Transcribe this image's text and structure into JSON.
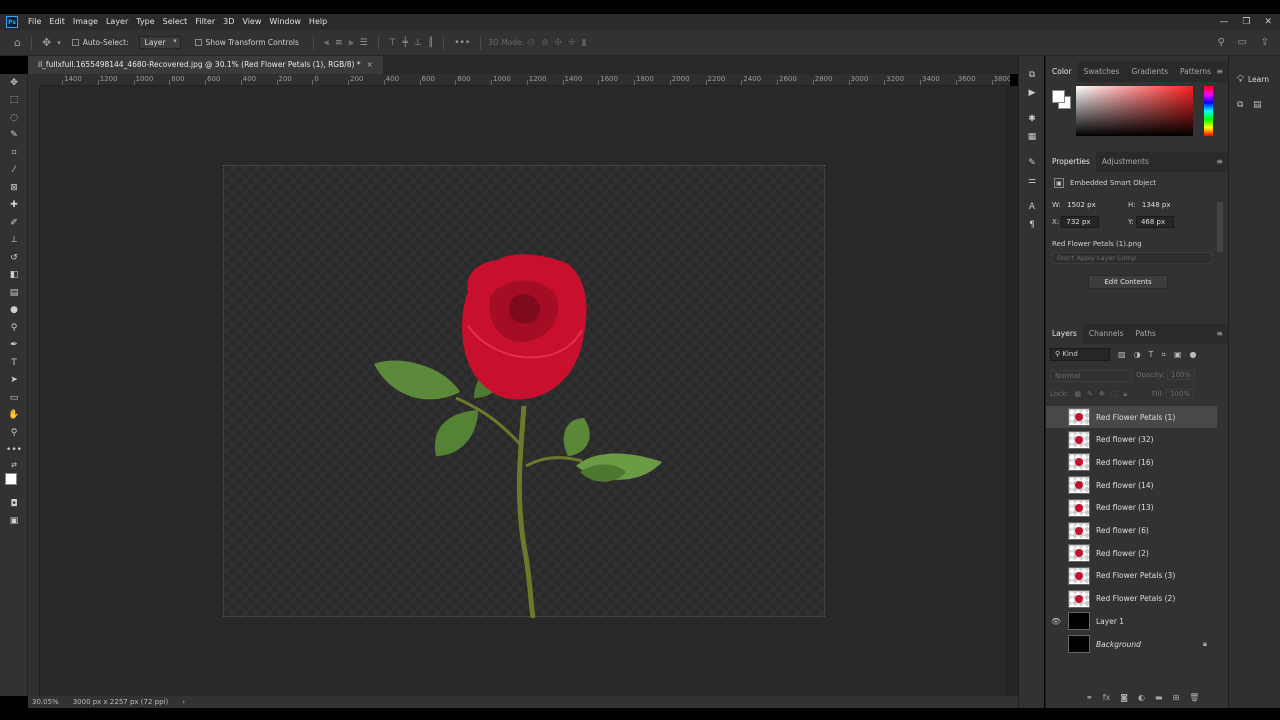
{
  "menu": {
    "logo": "Ps",
    "items": [
      "File",
      "Edit",
      "Image",
      "Layer",
      "Type",
      "Select",
      "Filter",
      "3D",
      "View",
      "Window",
      "Help"
    ],
    "window_controls": [
      "—",
      "❐",
      "✕"
    ]
  },
  "options": {
    "auto_select_label": "Auto-Select:",
    "auto_select_value": "Layer",
    "show_transform_label": "Show Transform Controls",
    "mode_3d_label": "3D Mode:"
  },
  "document": {
    "tab_title": "il_fullxfull.1655498144_4680-Recovered.jpg @ 30.1% (Red Flower Petals (1), RGB/8) *",
    "close_glyph": "×"
  },
  "ruler": {
    "h_ticks": [
      "1400",
      "1200",
      "1000",
      "800",
      "600",
      "400",
      "200",
      "0",
      "200",
      "400",
      "600",
      "800",
      "1000",
      "1200",
      "1400",
      "1600",
      "1800",
      "2000",
      "2200",
      "2400",
      "2600",
      "2800",
      "3000",
      "3200",
      "3400",
      "3600",
      "3800"
    ]
  },
  "status": {
    "zoom": "30.05%",
    "doc_size": "3000 px x 2257 px (72 ppi)",
    "arrow": "›"
  },
  "color_panel": {
    "tabs": [
      "Color",
      "Swatches",
      "Gradients",
      "Patterns"
    ]
  },
  "properties_panel": {
    "tabs": [
      "Properties",
      "Adjustments"
    ],
    "object_type": "Embedded Smart Object",
    "w_label": "W:",
    "w_value": "1502 px",
    "h_label": "H:",
    "h_value": "1348 px",
    "x_label": "X:",
    "x_value": "732 px",
    "y_label": "Y:",
    "y_value": "468 px",
    "file_name": "Red Flower Petals (1).png",
    "layer_comp": "Don't Apply Layer Comp",
    "edit_contents": "Edit Contents"
  },
  "layers_panel": {
    "tabs": [
      "Layers",
      "Channels",
      "Paths"
    ],
    "filter_kind": "Kind",
    "blend_mode": "Normal",
    "opacity_label": "Opacity:",
    "opacity_value": "100%",
    "lock_label": "Lock:",
    "fill_label": "Fill:",
    "fill_value": "100%",
    "layers": [
      {
        "name": "Red Flower Petals (1)",
        "selected": true,
        "visible": false,
        "thumb": "rose"
      },
      {
        "name": "Red flower (32)",
        "selected": false,
        "visible": false,
        "thumb": "rose"
      },
      {
        "name": "Red flower (16)",
        "selected": false,
        "visible": false,
        "thumb": "rose"
      },
      {
        "name": "Red flower (14)",
        "selected": false,
        "visible": false,
        "thumb": "rose"
      },
      {
        "name": "Red flower (13)",
        "selected": false,
        "visible": false,
        "thumb": "rose"
      },
      {
        "name": "Red flower (6)",
        "selected": false,
        "visible": false,
        "thumb": "rose"
      },
      {
        "name": "Red flower (2)",
        "selected": false,
        "visible": false,
        "thumb": "rose"
      },
      {
        "name": "Red Flower Petals (3)",
        "selected": false,
        "visible": false,
        "thumb": "rose"
      },
      {
        "name": "Red Flower Petals (2)",
        "selected": false,
        "visible": false,
        "thumb": "rose"
      },
      {
        "name": "Layer 1",
        "selected": false,
        "visible": true,
        "thumb": "black"
      },
      {
        "name": "Background",
        "selected": false,
        "visible": false,
        "thumb": "black",
        "locked": true
      }
    ]
  },
  "learn_panel": {
    "label": "Learn"
  },
  "colors": {
    "rose": "#c8102e",
    "leaf": "#4f7a32",
    "accent_ps": "#31a8ff"
  }
}
